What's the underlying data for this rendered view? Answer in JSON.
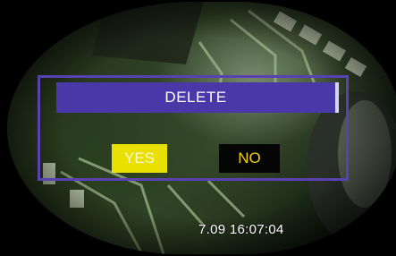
{
  "dialog": {
    "title": "DELETE",
    "yes_label": "YES",
    "no_label": "NO"
  },
  "overlay": {
    "timestamp": "7.09 16:07:04"
  },
  "colors": {
    "dialog_border": "#5a40b0",
    "title_bar": "#4b38a8",
    "yes_bg": "#e8e000",
    "no_text": "#f0d000"
  }
}
